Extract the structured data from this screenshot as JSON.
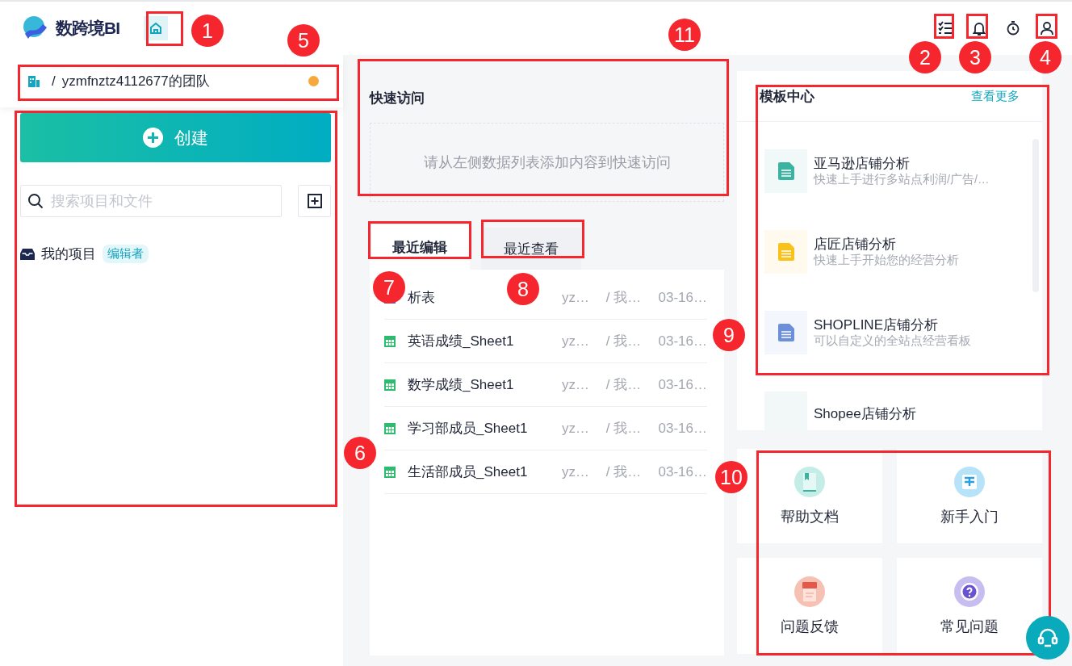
{
  "header": {
    "brand": "数跨境BI"
  },
  "team": {
    "separator": "/",
    "name": "yzmfnztz4112677的团队"
  },
  "sidebar": {
    "create_label": "创建",
    "search": {
      "placeholder": "搜索项目和文件"
    },
    "items": [
      {
        "label": "我的项目",
        "badge": "编辑者"
      }
    ]
  },
  "quick_access": {
    "title": "快速访问",
    "empty_text": "请从左侧数据列表添加内容到快速访问"
  },
  "recent": {
    "tabs": [
      {
        "label": "最近编辑",
        "selected": true
      },
      {
        "label": "最近查看",
        "selected": false
      }
    ],
    "rows": [
      {
        "kind": "chart",
        "name": "析表",
        "owner": "yz…",
        "folder": "/ 我…",
        "date": "03-16…"
      },
      {
        "kind": "table",
        "name": "英语成绩_Sheet1",
        "owner": "yz…",
        "folder": "/ 我…",
        "date": "03-16…"
      },
      {
        "kind": "table",
        "name": "数学成绩_Sheet1",
        "owner": "yz…",
        "folder": "/ 我…",
        "date": "03-16…"
      },
      {
        "kind": "table",
        "name": "学习部成员_Sheet1",
        "owner": "yz…",
        "folder": "/ 我…",
        "date": "03-16…"
      },
      {
        "kind": "table",
        "name": "生活部成员_Sheet1",
        "owner": "yz…",
        "folder": "/ 我…",
        "date": "03-16…"
      }
    ]
  },
  "templates": {
    "title": "模板中心",
    "more": "查看更多",
    "items": [
      {
        "title": "亚马逊店铺分析",
        "subtitle": "快速上手进行多站点利润/广告/…",
        "color": "#3bb3a0"
      },
      {
        "title": "店匠店铺分析",
        "subtitle": "快速上手开始您的经营分析",
        "color": "#f9c21a"
      },
      {
        "title": "SHOPLINE店铺分析",
        "subtitle": "可以自定义的全站点经营看板",
        "color": "#6b8fd8"
      },
      {
        "title": "Shopee店铺分析"
      }
    ]
  },
  "help": [
    {
      "kind": "book",
      "label": "帮助文档"
    },
    {
      "kind": "signpost",
      "label": "新手入门"
    },
    {
      "kind": "feedback",
      "label": "问题反馈"
    },
    {
      "kind": "question",
      "label": "常见问题"
    }
  ],
  "annotations": [
    {
      "label": "1"
    },
    {
      "label": "2"
    },
    {
      "label": "3"
    },
    {
      "label": "4"
    },
    {
      "label": "5"
    },
    {
      "label": "6"
    },
    {
      "label": "7"
    },
    {
      "label": "8"
    },
    {
      "label": "9"
    },
    {
      "label": "10"
    },
    {
      "label": "11"
    }
  ]
}
